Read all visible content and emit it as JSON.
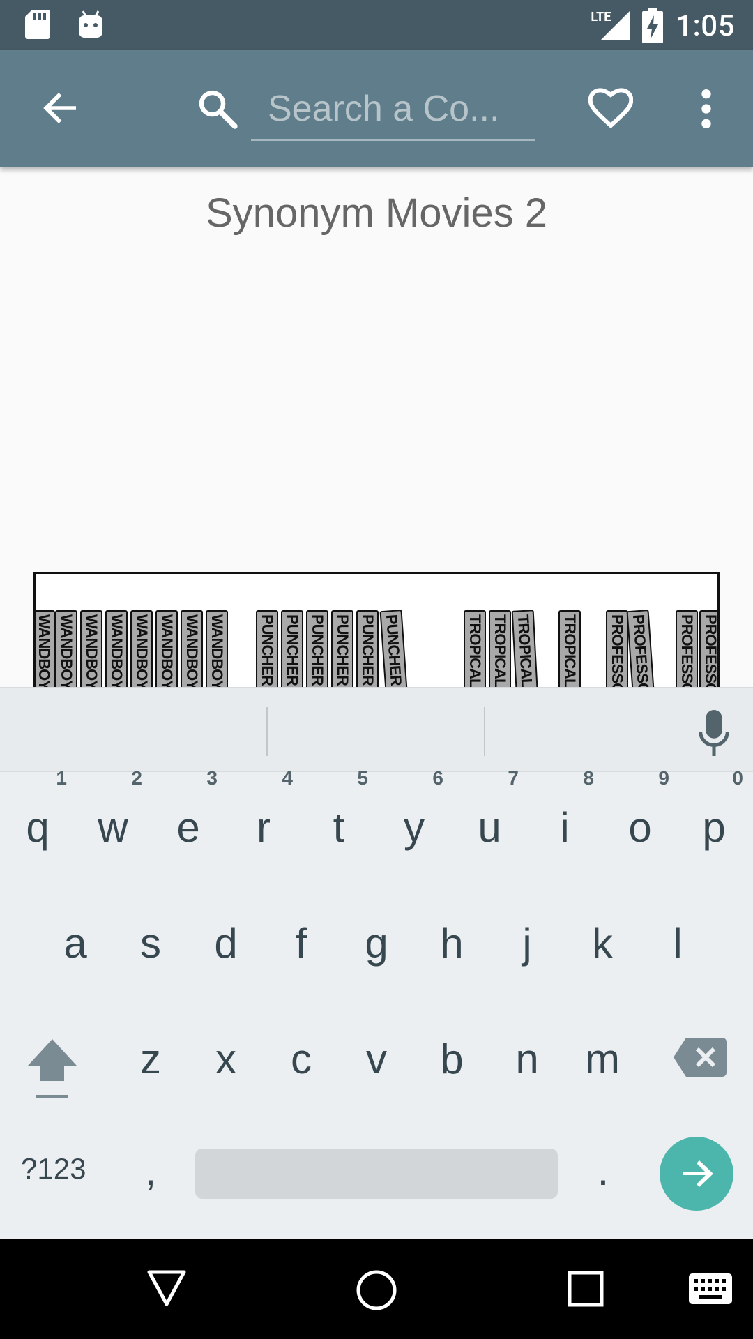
{
  "status_bar": {
    "time": "1:05",
    "network": "LTE",
    "icons": [
      "sd-card-icon",
      "android-icon",
      "signal-icon",
      "battery-charging-icon"
    ]
  },
  "toolbar": {
    "search_placeholder": "Search a Co...",
    "back_icon": "arrow-back-icon",
    "search_icon": "search-icon",
    "favorite_icon": "heart-outline-icon",
    "menu_icon": "more-vert-icon"
  },
  "comic": {
    "title": "Synonym Movies 2",
    "books": [
      {
        "label": "WANDBOY AN"
      },
      {
        "label": "WANDBOY AN"
      },
      {
        "label": "WANDBOY AN"
      },
      {
        "label": "WANDBOY AN"
      },
      {
        "label": "WANDBOY AN"
      },
      {
        "label": "WANDBOY AN"
      },
      {
        "label": "WANDBOY AN"
      },
      {
        "label": "WANDBOY AN"
      },
      {
        "label": "PUNCHER"
      },
      {
        "label": "PUNCHER"
      },
      {
        "label": "PUNCHER"
      },
      {
        "label": "PUNCHER"
      },
      {
        "label": "PUNCHER"
      },
      {
        "label": "PUNCHER"
      },
      {
        "label": "TROPICAL BO"
      },
      {
        "label": "TROPICAL BO"
      },
      {
        "label": "TROPICAL BO"
      },
      {
        "label": "TROPICAL BO"
      },
      {
        "label": "PROFESSOR L"
      },
      {
        "label": "PROFESSOR L"
      },
      {
        "label": "PROFESSOR L"
      },
      {
        "label": "PROFESSOR L"
      }
    ]
  },
  "keyboard": {
    "row1": [
      {
        "key": "q",
        "hint": "1"
      },
      {
        "key": "w",
        "hint": "2"
      },
      {
        "key": "e",
        "hint": "3"
      },
      {
        "key": "r",
        "hint": "4"
      },
      {
        "key": "t",
        "hint": "5"
      },
      {
        "key": "y",
        "hint": "6"
      },
      {
        "key": "u",
        "hint": "7"
      },
      {
        "key": "i",
        "hint": "8"
      },
      {
        "key": "o",
        "hint": "9"
      },
      {
        "key": "p",
        "hint": "0"
      }
    ],
    "row2": [
      "a",
      "s",
      "d",
      "f",
      "g",
      "h",
      "j",
      "k",
      "l"
    ],
    "row3": [
      "z",
      "x",
      "c",
      "v",
      "b",
      "n",
      "m"
    ],
    "symbols_label": "?123",
    "comma_label": ",",
    "period_label": ".",
    "accent_color": "#4db6ac"
  },
  "nav_bar": {
    "icons": [
      "back-triangle-icon",
      "home-circle-icon",
      "recents-square-icon",
      "keyboard-switch-icon"
    ]
  }
}
